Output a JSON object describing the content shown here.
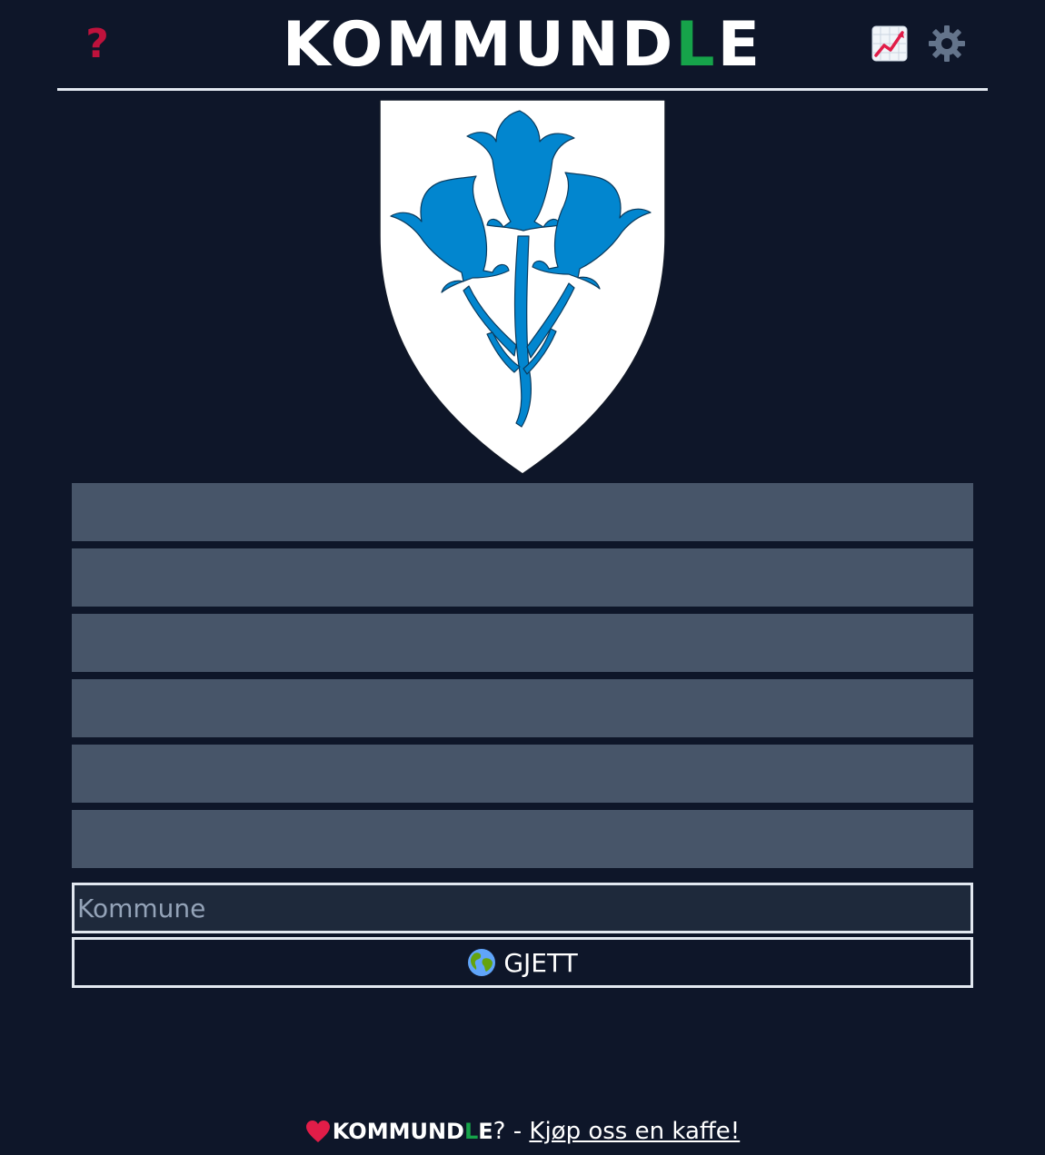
{
  "header": {
    "help_label": "?",
    "title_prefix": "KOMMUND",
    "title_highlight": "L",
    "title_suffix": "E"
  },
  "icons": {
    "help": "question-mark-icon",
    "stats": "chart-increasing-icon",
    "settings": "gear-icon",
    "guess": "globe-icon",
    "footer": "heart-icon"
  },
  "colors": {
    "background": "#0e1629",
    "highlight": "#16a34a",
    "help": "#be123c",
    "guess_row": "#475569",
    "border": "#e2e8f0",
    "crest_blue": "#0286cf"
  },
  "guess_rows": [
    "",
    "",
    "",
    "",
    "",
    ""
  ],
  "input": {
    "placeholder": "Kommune",
    "value": ""
  },
  "guess_button": {
    "label": "GJETT"
  },
  "footer": {
    "brand_prefix": "KOMMUND",
    "brand_highlight": "L",
    "brand_suffix": "E",
    "separator": "? - ",
    "link_label": "Kjøp oss en kaffe!"
  }
}
